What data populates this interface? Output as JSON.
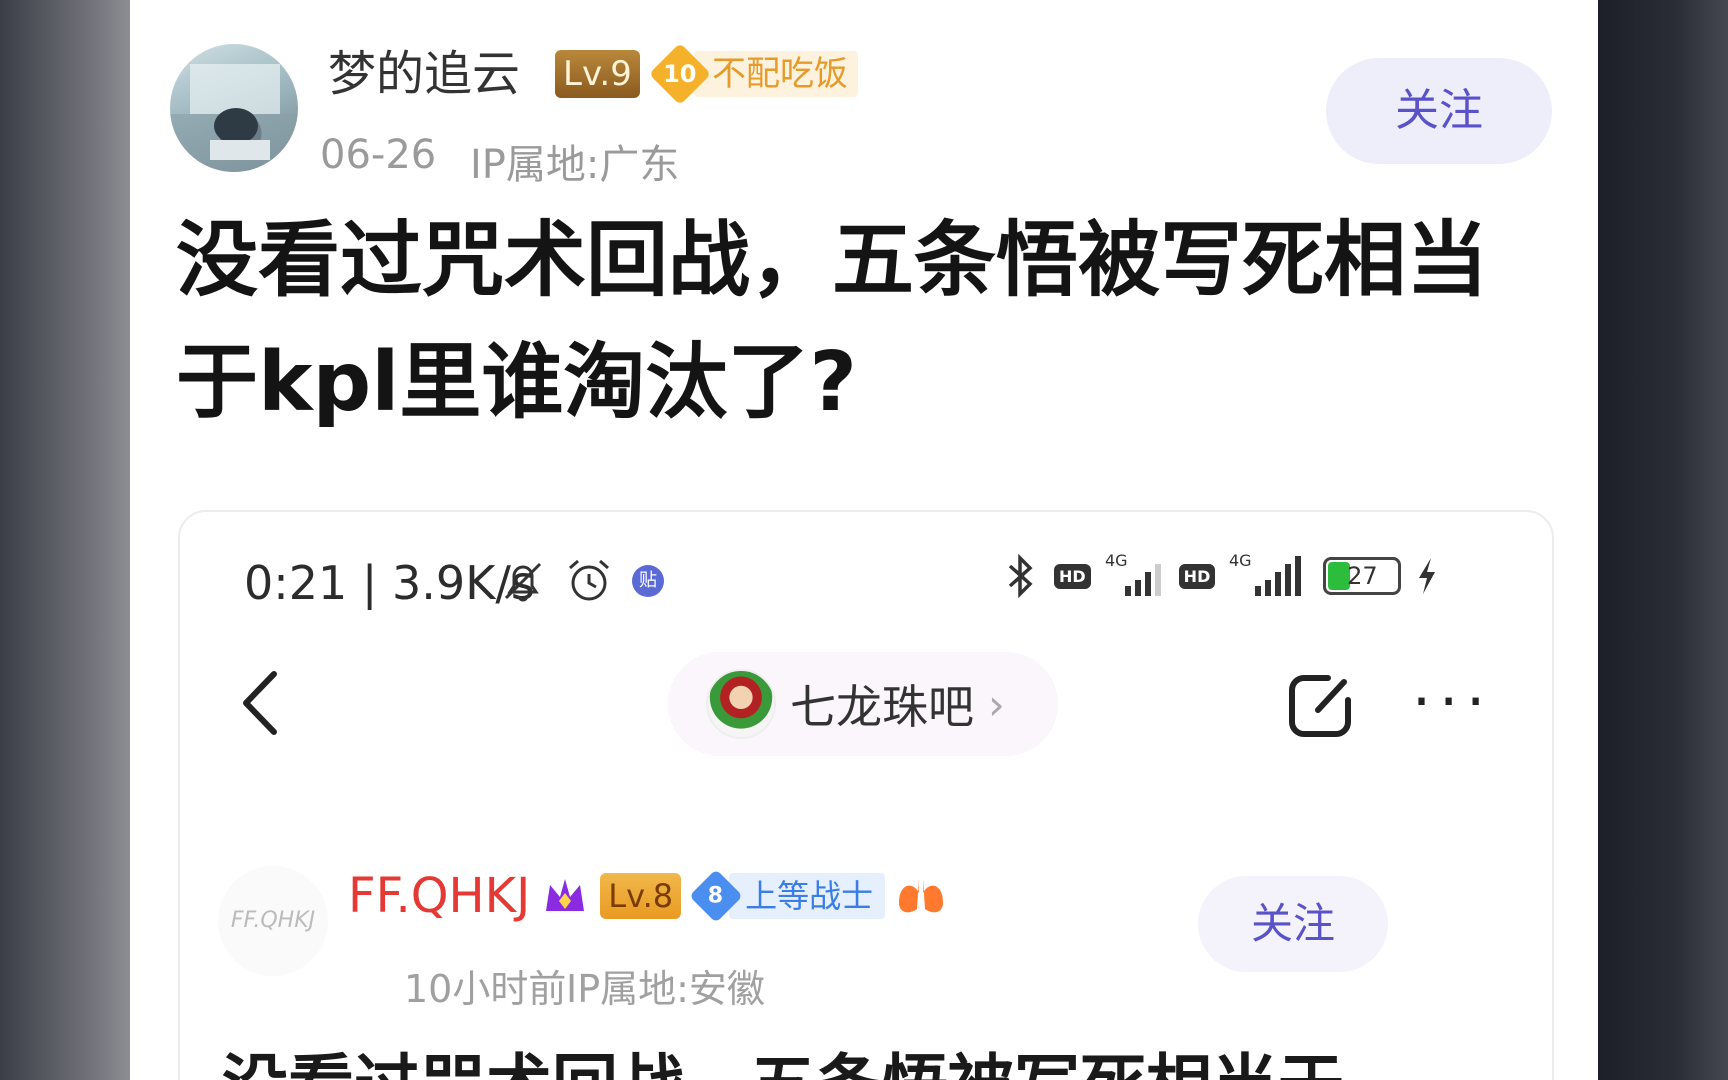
{
  "post": {
    "author": {
      "name": "梦的追云",
      "level": "Lv.9",
      "fan_level": "10",
      "fan_title": "不配吃饭"
    },
    "date": "06-26",
    "ip_location": "IP属地:广东",
    "follow_label": "关注",
    "title": "没看过咒术回战，五条悟被写死相当于kpl里谁淘汰了?"
  },
  "embedded_screenshot": {
    "status_bar": {
      "time": "0:21 | 3.9K/s",
      "signal_labels": [
        "4G",
        "4G"
      ],
      "hd_label": "HD",
      "battery": "27",
      "app_badge": "贴"
    },
    "forum": {
      "name": "七龙珠吧",
      "chevron": "›"
    },
    "author": {
      "name": "FF.QHKJ",
      "avatar_text": "FF.QHKJ",
      "level": "Lv.8",
      "fan_level": "8",
      "fan_title": "上等战士"
    },
    "time_ago": "10小时前",
    "ip_location": "IP属地:安徽",
    "follow_label": "关注",
    "title": "没看过咒术回战，五条悟被写死相当于"
  },
  "colors": {
    "accent": "#5a52c8",
    "follow_bg": "#eeeefa",
    "red_name": "#e53935",
    "gold_badge": "#f6b12a",
    "blue_badge": "#4a8ef0"
  },
  "icons": [
    "back-icon",
    "share-icon",
    "more-icon",
    "bell-off-icon",
    "alarm-icon",
    "bluetooth-icon",
    "crown-icon",
    "lungs-icon",
    "lightning-icon"
  ]
}
